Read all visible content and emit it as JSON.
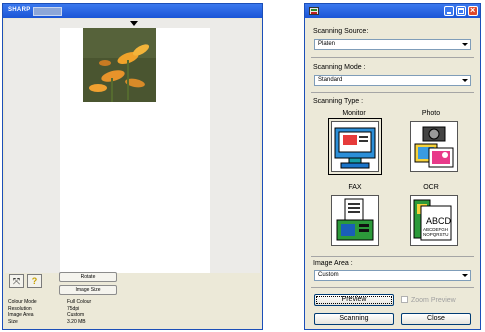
{
  "left_window": {
    "title": "SHARP",
    "buttons": {
      "rotate": "Rotate",
      "image_size": "Image Size"
    },
    "info": [
      {
        "label": "Colour Mode",
        "value": "Full Colour"
      },
      {
        "label": "Resolution",
        "value": "75dpi"
      },
      {
        "label": "Image Area",
        "value": "Custom"
      },
      {
        "label": "Size",
        "value": "3.20 MB"
      }
    ]
  },
  "right_window": {
    "scanning_source": {
      "label": "Scanning Source:",
      "value": "Platen"
    },
    "scanning_mode": {
      "label": "Scanning Mode :",
      "value": "Standard"
    },
    "scanning_type": {
      "label": "Scanning Type :",
      "options": [
        {
          "label": "Monitor",
          "selected": true
        },
        {
          "label": "Photo",
          "selected": false
        },
        {
          "label": "FAX",
          "selected": false
        },
        {
          "label": "OCR",
          "selected": false
        }
      ],
      "ocr_icon_text": [
        "ABCD",
        "ABCDEFGH",
        "NOPQRSTU"
      ]
    },
    "image_area": {
      "label": "Image Area :",
      "value": "Custom"
    },
    "buttons": {
      "preview": "Preview",
      "scanning": "Scanning",
      "close": "Close"
    },
    "zoom_preview": {
      "label": "Zoom Preview",
      "checked": false,
      "enabled": false
    }
  },
  "colors": {
    "titlebar": "#1b55d6",
    "window_bg": "#ece9d8",
    "close_button": "#e0492b"
  }
}
